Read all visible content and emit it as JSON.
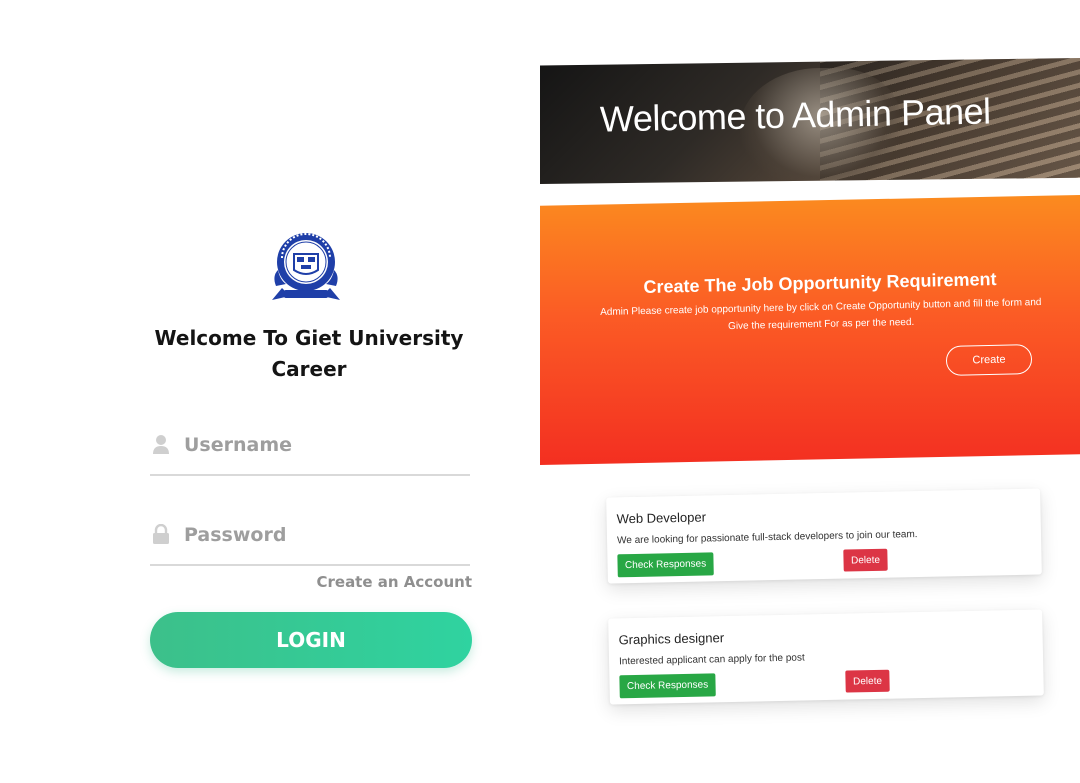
{
  "login": {
    "logo_icon": "university-seal-logo",
    "welcome_title": "Welcome To Giet University Career",
    "username_placeholder": "Username",
    "password_placeholder": "Password",
    "create_account": "Create an Account",
    "login_label": "LOGIN"
  },
  "admin": {
    "hero_title": "Welcome to Admin Panel",
    "banner": {
      "title": "Create The Job Opportunity Requirement",
      "text": "Admin Please create job opportunity here by click on Create Opportunity button and fill the form and Give the requirement For as per the need.",
      "create_label": "Create"
    },
    "jobs": [
      {
        "title": "Web Developer",
        "description": "We are looking for passionate full-stack developers to join our team.",
        "check_label": "Check Responses",
        "delete_label": "Delete"
      },
      {
        "title": "Graphics designer",
        "description": "Interested applicant can apply for the post",
        "check_label": "Check Responses",
        "delete_label": "Delete"
      }
    ]
  },
  "colors": {
    "login_gradient_start": "#3cc08a",
    "login_gradient_end": "#2fd3a0",
    "banner_top": "#fb8b1f",
    "banner_bottom": "#f32f21",
    "check_button": "#28a745",
    "delete_button": "#dc3545"
  }
}
